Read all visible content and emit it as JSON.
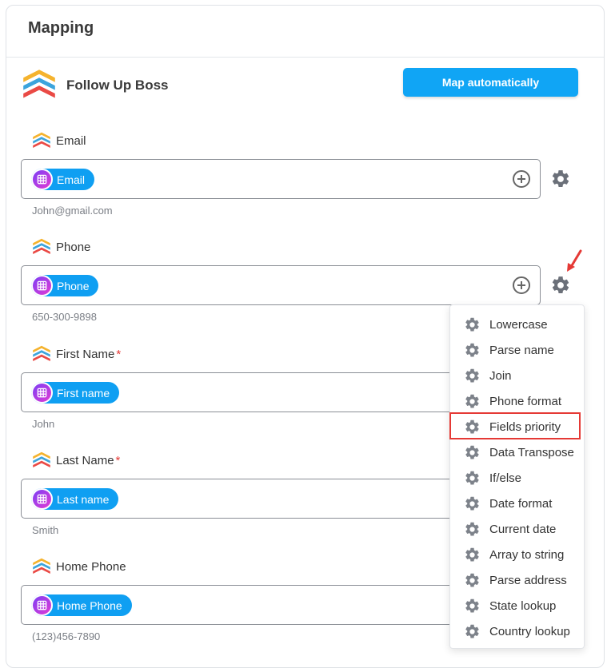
{
  "card": {
    "title": "Mapping"
  },
  "app": {
    "name": "Follow Up Boss",
    "logo_icon": "follow-up-boss-logo"
  },
  "map_button": {
    "label": "Map automatically"
  },
  "fields": [
    {
      "label": "Email",
      "required": false,
      "chip": "Email",
      "sample": "John@gmail.com"
    },
    {
      "label": "Phone",
      "required": false,
      "chip": "Phone",
      "sample": "650-300-9898"
    },
    {
      "label": "First Name",
      "required": true,
      "chip": "First name",
      "sample": "John"
    },
    {
      "label": "Last Name",
      "required": true,
      "chip": "Last name",
      "sample": "Smith"
    },
    {
      "label": "Home Phone",
      "required": false,
      "chip": "Home Phone",
      "sample": "(123)456-7890"
    }
  ],
  "required_marker": "*",
  "settings_menu": {
    "highlighted_item": "Fields priority",
    "items": [
      "Lowercase",
      "Parse name",
      "Join",
      "Phone format",
      "Fields priority",
      "Data Transpose",
      "If/else",
      "Date format",
      "Current date",
      "Array to string",
      "Parse address",
      "State lookup",
      "Country lookup"
    ]
  },
  "colors": {
    "accent": "#10a5f5",
    "chip": "#0f9ff2",
    "highlight_border": "#e53935",
    "gear": "#6b7079"
  }
}
